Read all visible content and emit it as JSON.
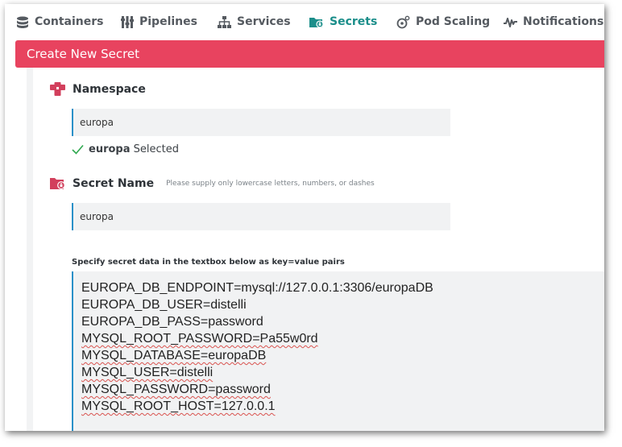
{
  "nav": {
    "items": [
      {
        "label": "Containers",
        "icon": "database-icon"
      },
      {
        "label": "Pipelines",
        "icon": "pipelines-icon"
      },
      {
        "label": "Services",
        "icon": "sitemap-icon"
      },
      {
        "label": "Secrets",
        "icon": "secret-folder-icon",
        "active": true
      },
      {
        "label": "Pod Scaling",
        "icon": "pod-scaling-icon"
      },
      {
        "label": "Notifications",
        "icon": "activity-icon"
      }
    ]
  },
  "header": {
    "title": "Create New Secret"
  },
  "namespace": {
    "label": "Namespace",
    "value": "europa",
    "selected_name": "europa",
    "selected_suffix": "Selected"
  },
  "secret_name": {
    "label": "Secret Name",
    "hint": "Please supply only lowercase letters, numbers, or dashes",
    "value": "europa"
  },
  "secret_data": {
    "label": "Specify secret data in the textbox below as key=value pairs",
    "lines": [
      "EUROPA_DB_ENDPOINT=mysql://127.0.0.1:3306/europaDB",
      "EUROPA_DB_USER=distelli",
      "EUROPA_DB_PASS=password",
      "MYSQL_ROOT_PASSWORD=Pa55w0rd",
      "MYSQL_DATABASE=europaDB",
      "MYSQL_USER=distelli",
      "MYSQL_PASSWORD=password",
      "MYSQL_ROOT_HOST=127.0.0.1"
    ]
  },
  "colors": {
    "header": "#e8435f",
    "active_nav": "#1b8e8a",
    "input_accent": "#2a90c8",
    "check": "#2fa84f",
    "icon": "#d23f5c"
  }
}
